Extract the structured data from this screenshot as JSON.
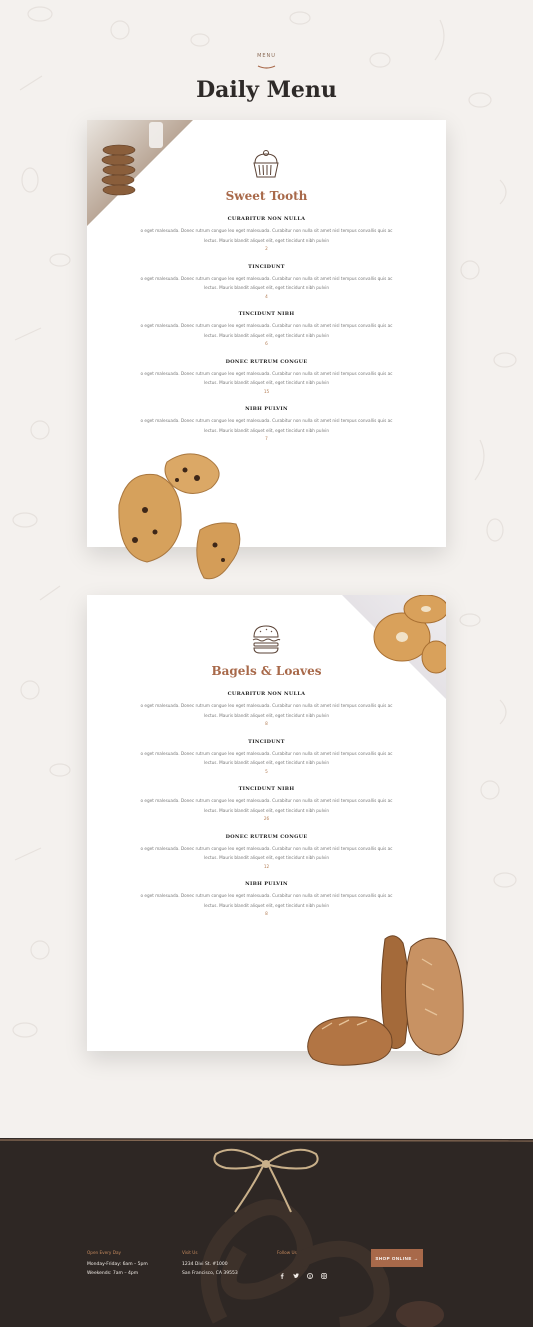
{
  "header": {
    "eyebrow": "MENU",
    "title": "Daily Menu"
  },
  "sections": [
    {
      "heading": "Sweet Tooth",
      "icon": "cupcake-icon",
      "items": [
        {
          "name": "CURABITUR NON NULLA",
          "desc": "o eget malesuada. Donec rutrum congue leo eget malesuada. Curabitur non nulla sit amet nisl tempus convallis quis ac lectus. Mauris blandit aliquet elit, eget tincidunt nibh pulvin",
          "price": "2"
        },
        {
          "name": "TINCIDUNT",
          "desc": "o eget malesuada. Donec rutrum congue leo eget malesuada. Curabitur non nulla sit amet nisl tempus convallis quis ac lectus. Mauris blandit aliquet elit, eget tincidunt nibh pulvin",
          "price": "4"
        },
        {
          "name": "TINCIDUNT NIBH",
          "desc": "o eget malesuada. Donec rutrum congue leo eget malesuada. Curabitur non nulla sit amet nisl tempus convallis quis ac lectus. Mauris blandit aliquet elit, eget tincidunt nibh pulvin",
          "price": "6"
        },
        {
          "name": "DONEC RUTRUM CONGUE",
          "desc": "o eget malesuada. Donec rutrum congue leo eget malesuada. Curabitur non nulla sit amet nisl tempus convallis quis ac lectus. Mauris blandit aliquet elit, eget tincidunt nibh pulvin",
          "price": "15"
        },
        {
          "name": "NIBH PULVIN",
          "desc": "o eget malesuada. Donec rutrum congue leo eget malesuada. Curabitur non nulla sit amet nisl tempus convallis quis ac lectus. Mauris blandit aliquet elit, eget tincidunt nibh pulvin",
          "price": "7"
        }
      ]
    },
    {
      "heading": "Bagels & Loaves",
      "icon": "burger-icon",
      "items": [
        {
          "name": "CURABITUR NON NULLA",
          "desc": "o eget malesuada. Donec rutrum congue leo eget malesuada. Curabitur non nulla sit amet nisl tempus convallis quis ac lectus. Mauris blandit aliquet elit, eget tincidunt nibh pulvin",
          "price": "8"
        },
        {
          "name": "TINCIDUNT",
          "desc": "o eget malesuada. Donec rutrum congue leo eget malesuada. Curabitur non nulla sit amet nisl tempus convallis quis ac lectus. Mauris blandit aliquet elit, eget tincidunt nibh pulvin",
          "price": "5"
        },
        {
          "name": "TINCIDUNT NIBH",
          "desc": "o eget malesuada. Donec rutrum congue leo eget malesuada. Curabitur non nulla sit amet nisl tempus convallis quis ac lectus. Mauris blandit aliquet elit, eget tincidunt nibh pulvin",
          "price": "26"
        },
        {
          "name": "DONEC RUTRUM CONGUE",
          "desc": "o eget malesuada. Donec rutrum congue leo eget malesuada. Curabitur non nulla sit amet nisl tempus convallis quis ac lectus. Mauris blandit aliquet elit, eget tincidunt nibh pulvin",
          "price": "12"
        },
        {
          "name": "NIBH PULVIN",
          "desc": "o eget malesuada. Donec rutrum congue leo eget malesuada. Curabitur non nulla sit amet nisl tempus convallis quis ac lectus. Mauris blandit aliquet elit, eget tincidunt nibh pulvin",
          "price": "8"
        }
      ]
    }
  ],
  "footer": {
    "hours": {
      "title": "Open Every Day",
      "line1": "Monday-Friday: 6am – 5pm",
      "line2": "Weekends: 7am – 4pm"
    },
    "visit": {
      "title": "Visit Us",
      "line1": "1234 Divi St. #1000",
      "line2": "San Francisco, CA 39553"
    },
    "follow": {
      "title": "Follow Us",
      "icons": [
        "facebook-icon",
        "twitter-icon",
        "pinterest-icon",
        "instagram-icon"
      ]
    },
    "shop_button": "SHOP ONLINE →"
  },
  "colors": {
    "accent": "#a8694a",
    "background": "#f4f1ee",
    "footer": "#2e2724"
  }
}
